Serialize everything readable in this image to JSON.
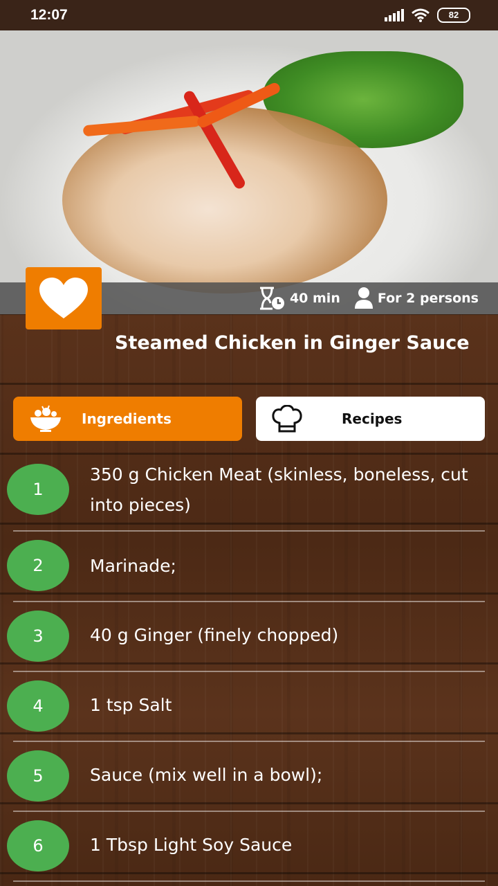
{
  "status_bar": {
    "time": "12:07",
    "battery": "82"
  },
  "recipe": {
    "title": "Steamed Chicken in Ginger Sauce",
    "time": "40 min",
    "servings": "For 2 persons"
  },
  "tabs": {
    "ingredients_label": "Ingredients",
    "recipes_label": "Recipes"
  },
  "ingredients": [
    {
      "num": "1",
      "text": "350 g Chicken Meat (skinless, boneless, cut into pieces)"
    },
    {
      "num": "2",
      "text": "Marinade;"
    },
    {
      "num": "3",
      "text": "40 g Ginger (finely chopped)"
    },
    {
      "num": "4",
      "text": "1 tsp Salt"
    },
    {
      "num": "5",
      "text": "Sauce (mix well in a bowl);"
    },
    {
      "num": "6",
      "text": "1 Tbsp Light Soy Sauce"
    }
  ],
  "colors": {
    "accent": "#ef7d00",
    "number_badge": "#4caf50"
  }
}
